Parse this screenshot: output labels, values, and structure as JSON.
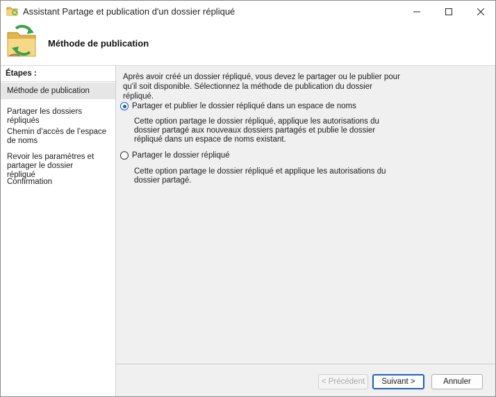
{
  "window": {
    "title": "Assistant Partage et publication d'un dossier répliqué"
  },
  "banner": {
    "title": "Méthode de publication"
  },
  "sidebar": {
    "heading": "Étapes :",
    "items": [
      {
        "label": "Méthode de publication",
        "active": true
      },
      {
        "label": "Partager les dossiers répliqués",
        "active": false
      },
      {
        "label": "Chemin d’accès de l’espace de noms",
        "active": false
      },
      {
        "label": "Revoir les paramètres et partager le dossier répliqué",
        "active": false
      },
      {
        "label": "Confirmation",
        "active": false
      }
    ]
  },
  "main": {
    "intro": "Après avoir créé un dossier répliqué, vous devez le partager ou le publier pour qu'il soit disponible. Sélectionnez la méthode de publication du dossier répliqué.",
    "options": [
      {
        "label": "Partager et publier le dossier répliqué dans un espace de noms",
        "selected": true,
        "description": "Cette option partage le dossier répliqué, applique les autorisations du dossier partagé aux nouveaux dossiers partagés et publie le dossier répliqué dans un espace de noms existant."
      },
      {
        "label": "Partager le dossier répliqué",
        "selected": false,
        "description": "Cette option partage le dossier répliqué et applique les autorisations du dossier partagé."
      }
    ]
  },
  "buttons": {
    "previous": "< Précédent",
    "next": "Suivant >",
    "cancel": "Annuler"
  },
  "colors": {
    "accent": "#1a5fb4",
    "content_background": "#f0f0f0",
    "active_step": "#e6e6e6"
  }
}
